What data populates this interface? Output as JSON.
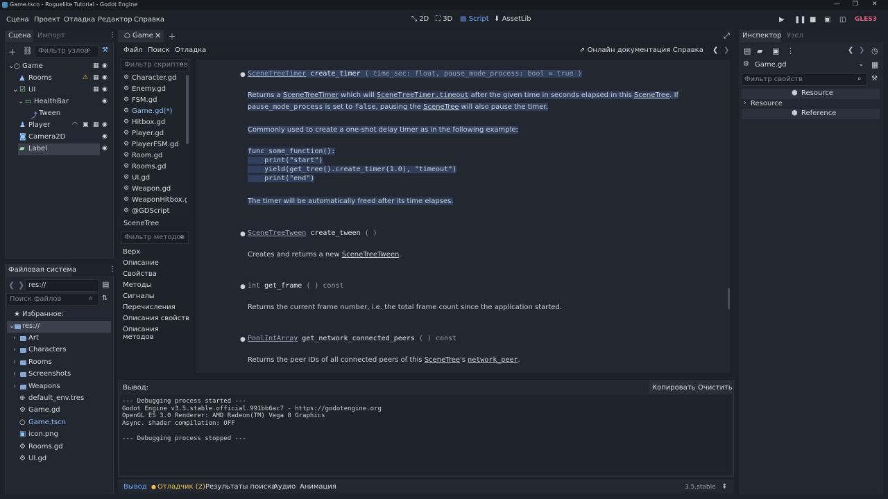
{
  "window": {
    "title": "Game.tscn - Roguelike Tutorial - Godot Engine",
    "controls": [
      "—",
      "❐",
      "✕"
    ]
  },
  "menu": [
    "Сцена",
    "Проект",
    "Отладка",
    "Редактор",
    "Справка"
  ],
  "workspaces": [
    {
      "label": "2D"
    },
    {
      "label": "3D"
    },
    {
      "label": "Script"
    },
    {
      "label": "AssetLib"
    }
  ],
  "renderer": "GLES3",
  "scene_dock": {
    "tabs": [
      "Сцена",
      "Импорт"
    ],
    "filter_placeholder": "Фильтр узлов",
    "tree": [
      {
        "name": "Game",
        "icon": "node-icon"
      },
      {
        "name": "Rooms",
        "icon": "node2d-icon"
      },
      {
        "name": "UI",
        "icon": "control-icon"
      },
      {
        "name": "HealthBar",
        "icon": "progressbar-icon"
      },
      {
        "name": "Tween",
        "icon": "tween-icon"
      },
      {
        "name": "Player",
        "icon": "kinematic-icon"
      },
      {
        "name": "Camera2D",
        "icon": "camera-icon"
      },
      {
        "name": "Label",
        "icon": "label-icon"
      }
    ]
  },
  "filesystem": {
    "title": "Файловая система",
    "path": "res://",
    "search_placeholder": "Поиск файлов",
    "favorites": "Избранное:",
    "root": "res://",
    "items": [
      {
        "name": "Art",
        "type": "folder"
      },
      {
        "name": "Characters",
        "type": "folder"
      },
      {
        "name": "Rooms",
        "type": "folder"
      },
      {
        "name": "Screenshots",
        "type": "folder"
      },
      {
        "name": "Weapons",
        "type": "folder"
      },
      {
        "name": "default_env.tres",
        "type": "resource"
      },
      {
        "name": "Game.gd",
        "type": "script"
      },
      {
        "name": "Game.tscn",
        "type": "scene"
      },
      {
        "name": "icon.png",
        "type": "image"
      },
      {
        "name": "Rooms.gd",
        "type": "script"
      },
      {
        "name": "UI.gd",
        "type": "script"
      }
    ]
  },
  "editor": {
    "tab": "Game",
    "menu": [
      "Файл",
      "Поиск",
      "Отладка"
    ],
    "online_docs": "Онлайн документация",
    "help": "Справка",
    "script_filter": "Фильтр скриптов",
    "scripts": [
      "Character.gd",
      "Enemy.gd",
      "FSM.gd",
      "Game.gd(*)",
      "Hitbox.gd",
      "Player.gd",
      "PlayerFSM.gd",
      "Room.gd",
      "Rooms.gd",
      "UI.gd",
      "Weapon.gd",
      "WeaponHitbox.gd",
      "@GDScript"
    ],
    "class_title": "SceneTree",
    "method_filter": "Фильтр методов",
    "sections": [
      "Верх",
      "Описание",
      "Свойства",
      "Методы",
      "Сигналы",
      "Перечисления",
      "Описания свойств",
      "Описания методов"
    ]
  },
  "doc": {
    "m1": {
      "ret": "SceneTreeTimer",
      "name": "create_timer",
      "args": "( time_sec: float, pause_mode_process: bool = true )"
    },
    "m1_desc1a": "Returns a ",
    "m1_desc1b": "SceneTreeTimer",
    "m1_desc1c": " which will ",
    "m1_desc1d": "SceneTreeTimer.timeout",
    "m1_desc1e": " after the given time in seconds elapsed in this ",
    "m1_desc1f": "SceneTree",
    "m1_desc1g": ". If",
    "m1_desc2a": "pause_mode_process",
    "m1_desc2b": " is set to ",
    "m1_desc2c": "false",
    "m1_desc2d": ", pausing the ",
    "m1_desc2e": "SceneTree",
    "m1_desc2f": " will also pause the timer.",
    "m1_common": "Commonly used to create a one-shot delay timer as in the following example:",
    "code": [
      "func some_function():",
      "    print(\"start\")",
      "    yield(get_tree().create_timer(1.0), \"timeout\")",
      "    print(\"end\")"
    ],
    "m1_freed": "The timer will be automatically freed after its time elapses.",
    "m2": {
      "ret": "SceneTreeTween",
      "name": "create_tween",
      "args": "( )"
    },
    "m2_desc_a": "Creates and returns a new ",
    "m2_desc_b": "SceneTreeTween",
    "m2_desc_c": ".",
    "m3": {
      "ret": "int",
      "name": "get_frame",
      "args": "( )",
      "qual": "const"
    },
    "m3_desc": "Returns the current frame number, i.e. the total frame count since the application started.",
    "m4": {
      "ret": "PoolIntArray",
      "name": "get_network_connected_peers",
      "args": "( )",
      "qual": "const"
    },
    "m4_desc_a": "Returns the peer IDs of all connected peers of this ",
    "m4_desc_b": "SceneTree",
    "m4_desc_c": "'s ",
    "m4_desc_d": "network_peer",
    "m4_desc_e": "."
  },
  "output": {
    "label": "Вывод:",
    "copy": "Копировать",
    "clear": "Очистить",
    "lines": [
      "--- Debugging process started ---",
      "Godot Engine v3.5.stable.official.991bb6ac7 - https://godotengine.org",
      "OpenGL ES 3.0 Renderer: AMD Radeon(TM) Vega 8 Graphics",
      "Async. shader compilation: OFF",
      "",
      "--- Debugging process stopped ---"
    ]
  },
  "bottom_tabs": [
    "Вывод",
    "Отладчик (2)",
    "Результаты поиска",
    "Аудио",
    "Анимация"
  ],
  "version": "3.5.stable",
  "inspector": {
    "tabs": [
      "Инспектор",
      "Узел"
    ],
    "resource": "Game.gd",
    "filter_placeholder": "Фильтр свойств",
    "sections": [
      "Resource",
      "Resource",
      "Reference"
    ]
  },
  "colors": {
    "accent": "#6ba4ff",
    "background": "#1d2229",
    "panel": "#232830",
    "selection": "#2f3f5c",
    "gles": "#e0607e",
    "warning": "#f0c040"
  }
}
